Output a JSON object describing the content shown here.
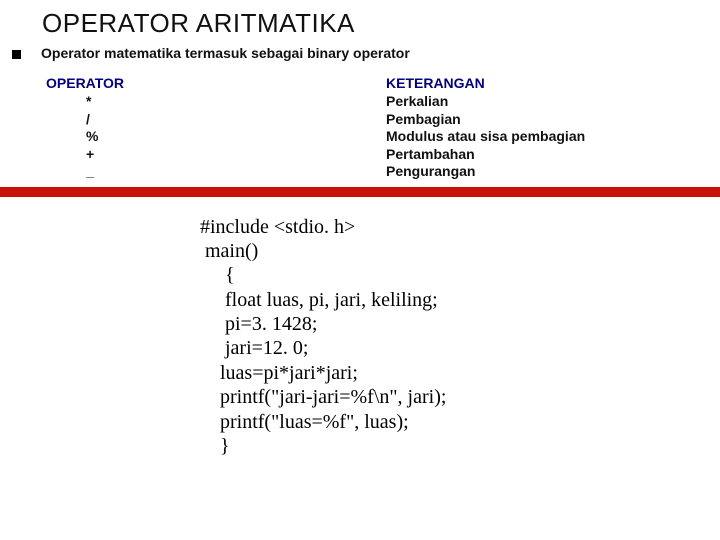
{
  "title": "OPERATOR ARITMATIKA",
  "subtitle": "Operator matematika termasuk sebagai binary operator",
  "headers": {
    "operator": "OPERATOR",
    "keterangan": "KETERANGAN"
  },
  "rows": [
    {
      "op": "*",
      "ket": "Perkalian"
    },
    {
      "op": "/",
      "ket": "Pembagian"
    },
    {
      "op": "%",
      "ket": "Modulus atau sisa pembagian"
    },
    {
      "op": "+",
      "ket": "Pertambahan"
    },
    {
      "op": "_",
      "ket": "Pengurangan"
    }
  ],
  "code": [
    "#include <stdio. h>",
    " main()",
    "     {",
    "     float luas, pi, jari, keliling;",
    "     pi=3. 1428;",
    "     jari=12. 0;",
    "    luas=pi*jari*jari;",
    "    printf(\"jari-jari=%f\\n\", jari);",
    "    printf(\"luas=%f\", luas);",
    "    }"
  ]
}
